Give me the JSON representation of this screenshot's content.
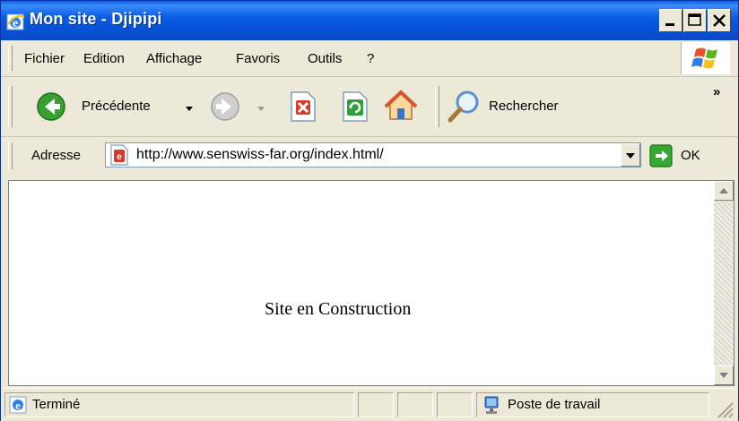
{
  "window": {
    "title": "Mon site - Djipipi",
    "buttons": {
      "minimize": "minimize-icon",
      "maximize": "maximize-icon",
      "close": "close-icon"
    }
  },
  "menu": {
    "items": [
      "Fichier",
      "Edition",
      "Affichage",
      "Favoris",
      "Outils",
      "?"
    ]
  },
  "toolbar": {
    "back_label": "Précédente",
    "search_label": "Rechercher",
    "more": "»",
    "icons": [
      "back-arrow-icon",
      "forward-arrow-icon",
      "stop-icon",
      "refresh-icon",
      "home-icon",
      "search-icon"
    ]
  },
  "address": {
    "label": "Adresse",
    "url": "http://www.senswiss-far.org/index.html/",
    "go_label": "OK"
  },
  "page": {
    "text": "Site en Construction"
  },
  "status": {
    "text": "Terminé",
    "zone": "Poste de travail"
  },
  "colors": {
    "titlebar": "#0a5ee8",
    "chrome": "#ece9d8",
    "close_button": "#ece9d8"
  }
}
